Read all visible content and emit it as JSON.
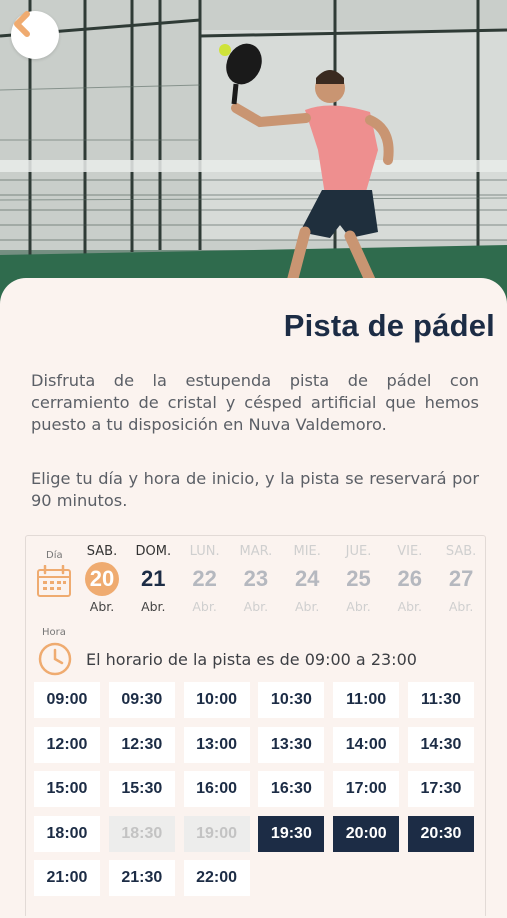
{
  "colors": {
    "accent": "#efab70",
    "navy": "#1c2c45",
    "background": "#fbf3ef"
  },
  "header": {
    "back_icon": "chevron-left-icon"
  },
  "title": "Pista de pádel",
  "description": "Disfruta de la estupenda pista de pádel con cerramiento de cristal y césped artificial que hemos puesto a tu disposición en Nuva Valdemoro.",
  "instructions": "Elige tu día y hora de inicio, y la pista se reservará por 90 minutos.",
  "calendar": {
    "label": "Día",
    "icon": "calendar-icon",
    "days": [
      {
        "dow": "SAB.",
        "num": "20",
        "month": "Abr.",
        "state": "selected"
      },
      {
        "dow": "DOM.",
        "num": "21",
        "month": "Abr.",
        "state": "available"
      },
      {
        "dow": "LUN.",
        "num": "22",
        "month": "Abr.",
        "state": "disabled"
      },
      {
        "dow": "MAR.",
        "num": "23",
        "month": "Abr.",
        "state": "disabled"
      },
      {
        "dow": "MIE.",
        "num": "24",
        "month": "Abr.",
        "state": "disabled"
      },
      {
        "dow": "JUE.",
        "num": "25",
        "month": "Abr.",
        "state": "disabled"
      },
      {
        "dow": "VIE.",
        "num": "26",
        "month": "Abr.",
        "state": "disabled"
      },
      {
        "dow": "SAB.",
        "num": "27",
        "month": "Abr.",
        "state": "disabled"
      }
    ]
  },
  "hours": {
    "label": "Hora",
    "icon": "clock-icon",
    "note": "El horario de la pista es de 09:00 a 23:00",
    "slots": [
      {
        "time": "09:00",
        "state": "available"
      },
      {
        "time": "09:30",
        "state": "available"
      },
      {
        "time": "10:00",
        "state": "available"
      },
      {
        "time": "10:30",
        "state": "available"
      },
      {
        "time": "11:00",
        "state": "available"
      },
      {
        "time": "11:30",
        "state": "available"
      },
      {
        "time": "12:00",
        "state": "available"
      },
      {
        "time": "12:30",
        "state": "available"
      },
      {
        "time": "13:00",
        "state": "available"
      },
      {
        "time": "13:30",
        "state": "available"
      },
      {
        "time": "14:00",
        "state": "available"
      },
      {
        "time": "14:30",
        "state": "available"
      },
      {
        "time": "15:00",
        "state": "available"
      },
      {
        "time": "15:30",
        "state": "available"
      },
      {
        "time": "16:00",
        "state": "available"
      },
      {
        "time": "16:30",
        "state": "available"
      },
      {
        "time": "17:00",
        "state": "available"
      },
      {
        "time": "17:30",
        "state": "available"
      },
      {
        "time": "18:00",
        "state": "available"
      },
      {
        "time": "18:30",
        "state": "disabled"
      },
      {
        "time": "19:00",
        "state": "disabled"
      },
      {
        "time": "19:30",
        "state": "selected"
      },
      {
        "time": "20:00",
        "state": "selected"
      },
      {
        "time": "20:30",
        "state": "selected"
      },
      {
        "time": "21:00",
        "state": "available"
      },
      {
        "time": "21:30",
        "state": "available"
      },
      {
        "time": "22:00",
        "state": "available"
      }
    ]
  }
}
